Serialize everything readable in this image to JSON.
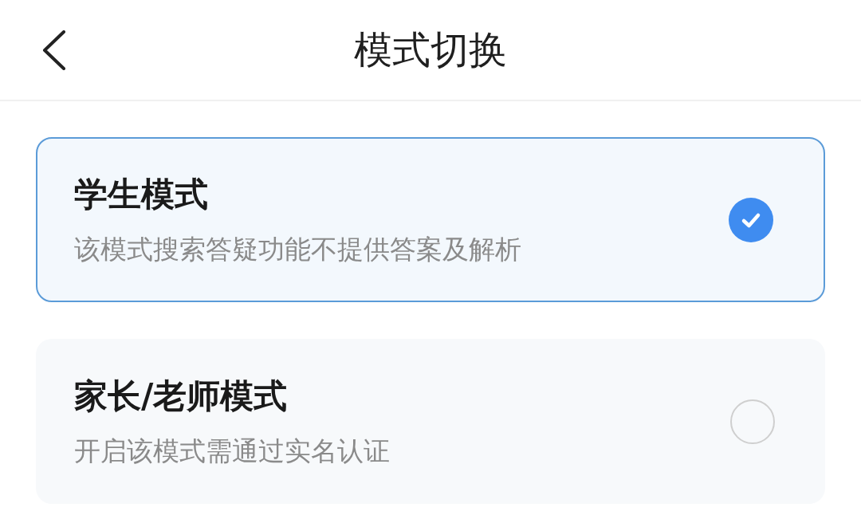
{
  "header": {
    "title": "模式切换"
  },
  "modes": [
    {
      "title": "学生模式",
      "description": "该模式搜索答疑功能不提供答案及解析",
      "selected": true
    },
    {
      "title": "家长/老师模式",
      "description": "开启该模式需通过实名认证",
      "selected": false
    }
  ]
}
